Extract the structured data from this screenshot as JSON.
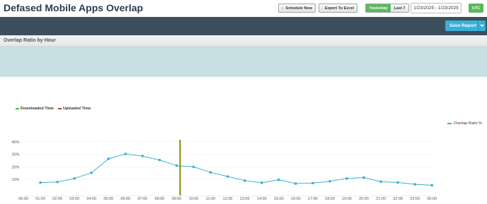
{
  "header": {
    "title": "Defased Mobile Apps Overlap",
    "schedule_label": "Schedule Now",
    "export_label": "Export To Excel",
    "range_yesterday": "Yesterday",
    "range_last7": "Last 7",
    "date_range": "1/23/2025 - 1/23/2025",
    "timezone": "UTC"
  },
  "toolbar": {
    "save_report_label": "Save Report"
  },
  "section": {
    "title": "Overlap Ratio by Hour"
  },
  "legend": {
    "downloaded": "Downloaded Time",
    "uploaded": "Uploaded Time",
    "series": "Overlap Ratio %"
  },
  "colors": {
    "accent": "#3ab0d6",
    "green": "#5cb85c",
    "downloaded": "#4caf50",
    "uploaded": "#c0392b",
    "marker": "#8a8a00",
    "darkbar": "#3d4e5c"
  },
  "chart_data": {
    "type": "line",
    "x": [
      "00:00",
      "01:00",
      "02:00",
      "03:00",
      "04:00",
      "05:00",
      "06:00",
      "07:00",
      "08:00",
      "09:00",
      "10:00",
      "11:00",
      "12:00",
      "13:00",
      "14:00",
      "15:00",
      "16:00",
      "17:00",
      "18:00",
      "19:00",
      "20:00",
      "21:00",
      "22:00",
      "23:00",
      "00:00"
    ],
    "series": [
      {
        "name": "Overlap Ratio %",
        "values": [
          null,
          7.3,
          7.8,
          10.6,
          15.2,
          26.4,
          30.3,
          28.6,
          25.4,
          20.9,
          19.9,
          15.5,
          12.2,
          8.9,
          7.1,
          9.6,
          6.5,
          6.9,
          8.3,
          10.6,
          11.3,
          8.0,
          7.4,
          5.9,
          5.2
        ]
      }
    ],
    "yticks": [
      "10%",
      "20%",
      "30%",
      "40%"
    ],
    "ylim": [
      0,
      40
    ],
    "marker_at": "09:00",
    "grid": true,
    "legend_placement": "right"
  }
}
